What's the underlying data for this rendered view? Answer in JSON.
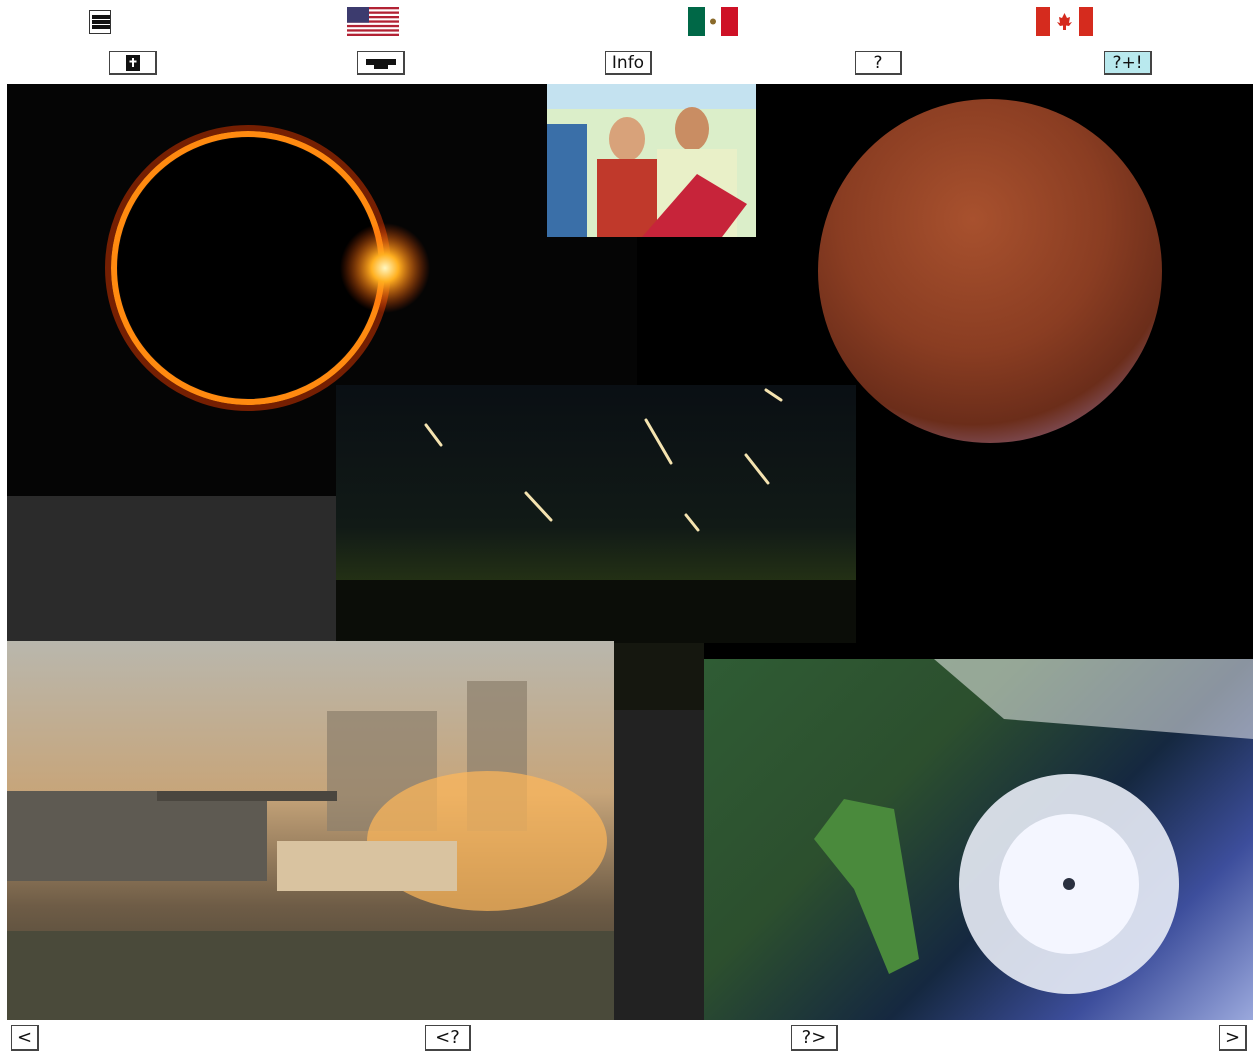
{
  "top_bar": {
    "menu_icon": "hamburger-icon",
    "flags": [
      "us-flag-icon",
      "mexico-flag-icon",
      "canada-flag-icon"
    ]
  },
  "toolbar": {
    "bible_icon": "bible-icon",
    "graduation_icon": "graduation-cap-icon",
    "info_label": "Info",
    "help_label": "?",
    "quiz_label": "?+!"
  },
  "colors": {
    "quiz_button_bg": "#b9e9ee"
  },
  "gallery": {
    "images": [
      "solar-eclipse",
      "bible-scene",
      "lunar-eclipse",
      "meteor-shower",
      "tank-battle",
      "hurricane-satellite"
    ]
  },
  "bottom_nav": {
    "prev_label": "<",
    "random_prev_label": "<?",
    "random_next_label": "?>",
    "next_label": ">"
  }
}
